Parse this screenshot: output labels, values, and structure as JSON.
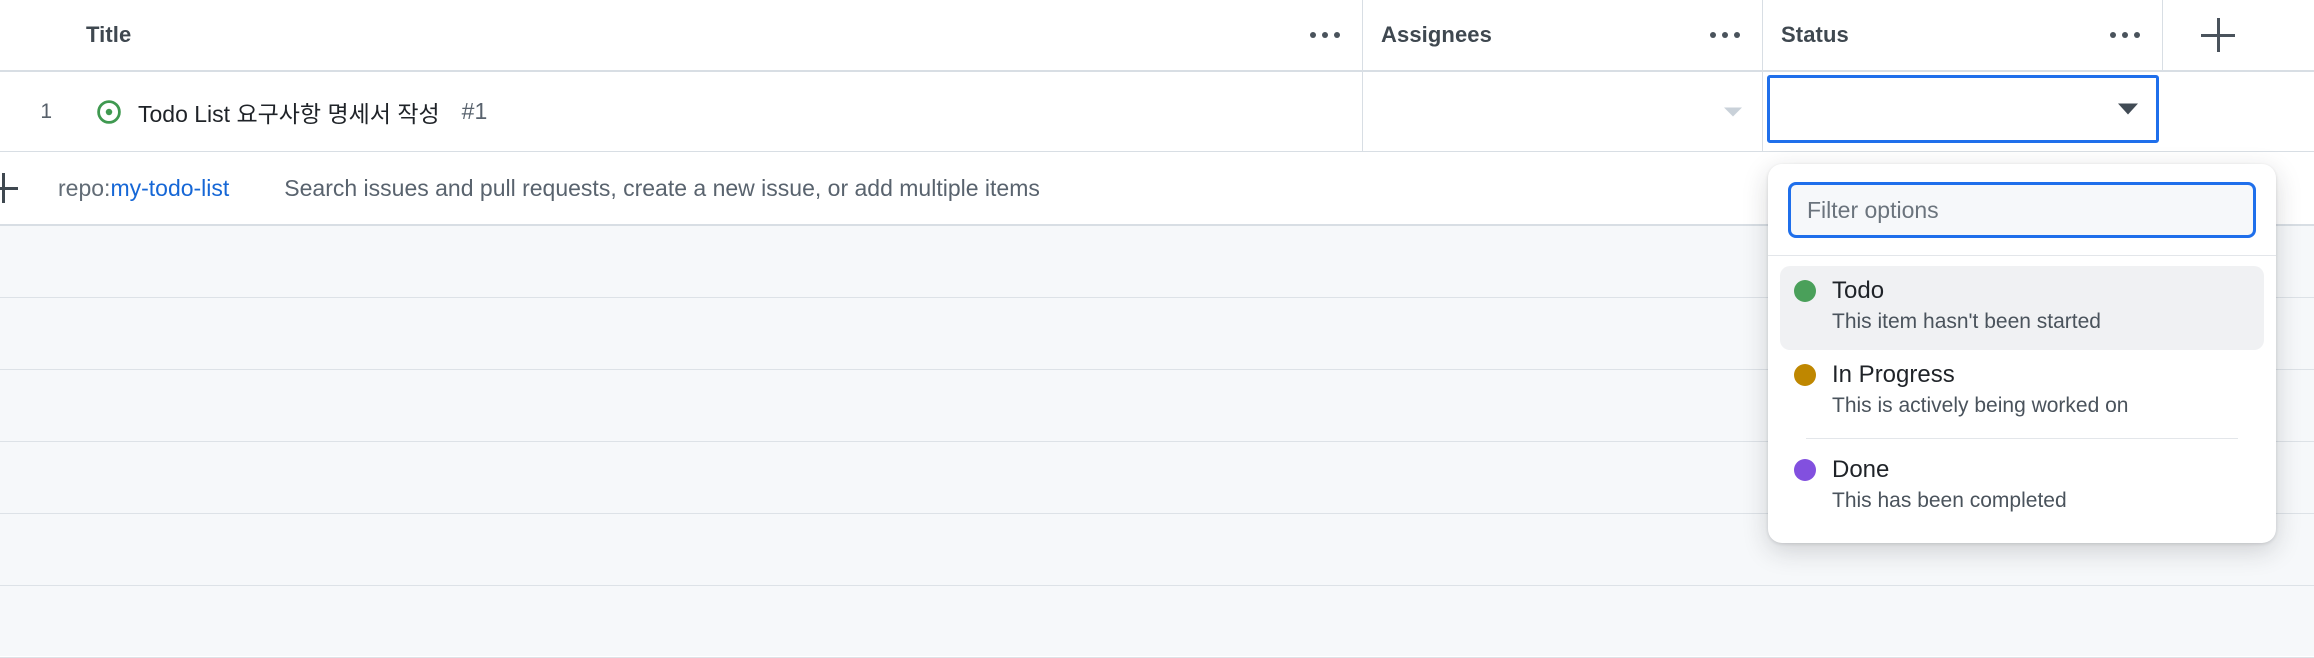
{
  "colors": {
    "accent_blue": "#1f6feb",
    "link_blue": "#1667d6",
    "open_issue_green": "#3f9950",
    "row_bg": "#f6f8fa",
    "border": "#d8dee4"
  },
  "table": {
    "columns": [
      {
        "key": "title",
        "label": "Title"
      },
      {
        "key": "assignees",
        "label": "Assignees"
      },
      {
        "key": "status",
        "label": "Status"
      }
    ],
    "add_column_label": "+",
    "rows": [
      {
        "number": "1",
        "icon": "open-issue-icon",
        "title": "Todo List 요구사항 명세서 작성",
        "issue_number": "#1",
        "assignees": "",
        "status": ""
      }
    ],
    "empty_row_count": 6
  },
  "search_row": {
    "add_icon": "plus-icon",
    "repo_prefix": "repo:",
    "repo_name": "my-todo-list",
    "placeholder": "Search issues and pull requests, create a new issue, or add multiple items"
  },
  "status_dropdown": {
    "filter_placeholder": "Filter options",
    "filter_value": "",
    "options": [
      {
        "name": "Todo",
        "description": "This item hasn't been started",
        "color": "#4aa05a",
        "active": true
      },
      {
        "name": "In Progress",
        "description": "This is actively being worked on",
        "color": "#bf8700",
        "active": false
      },
      {
        "name": "Done",
        "description": "This has been completed",
        "color": "#8250df",
        "active": false
      }
    ]
  }
}
